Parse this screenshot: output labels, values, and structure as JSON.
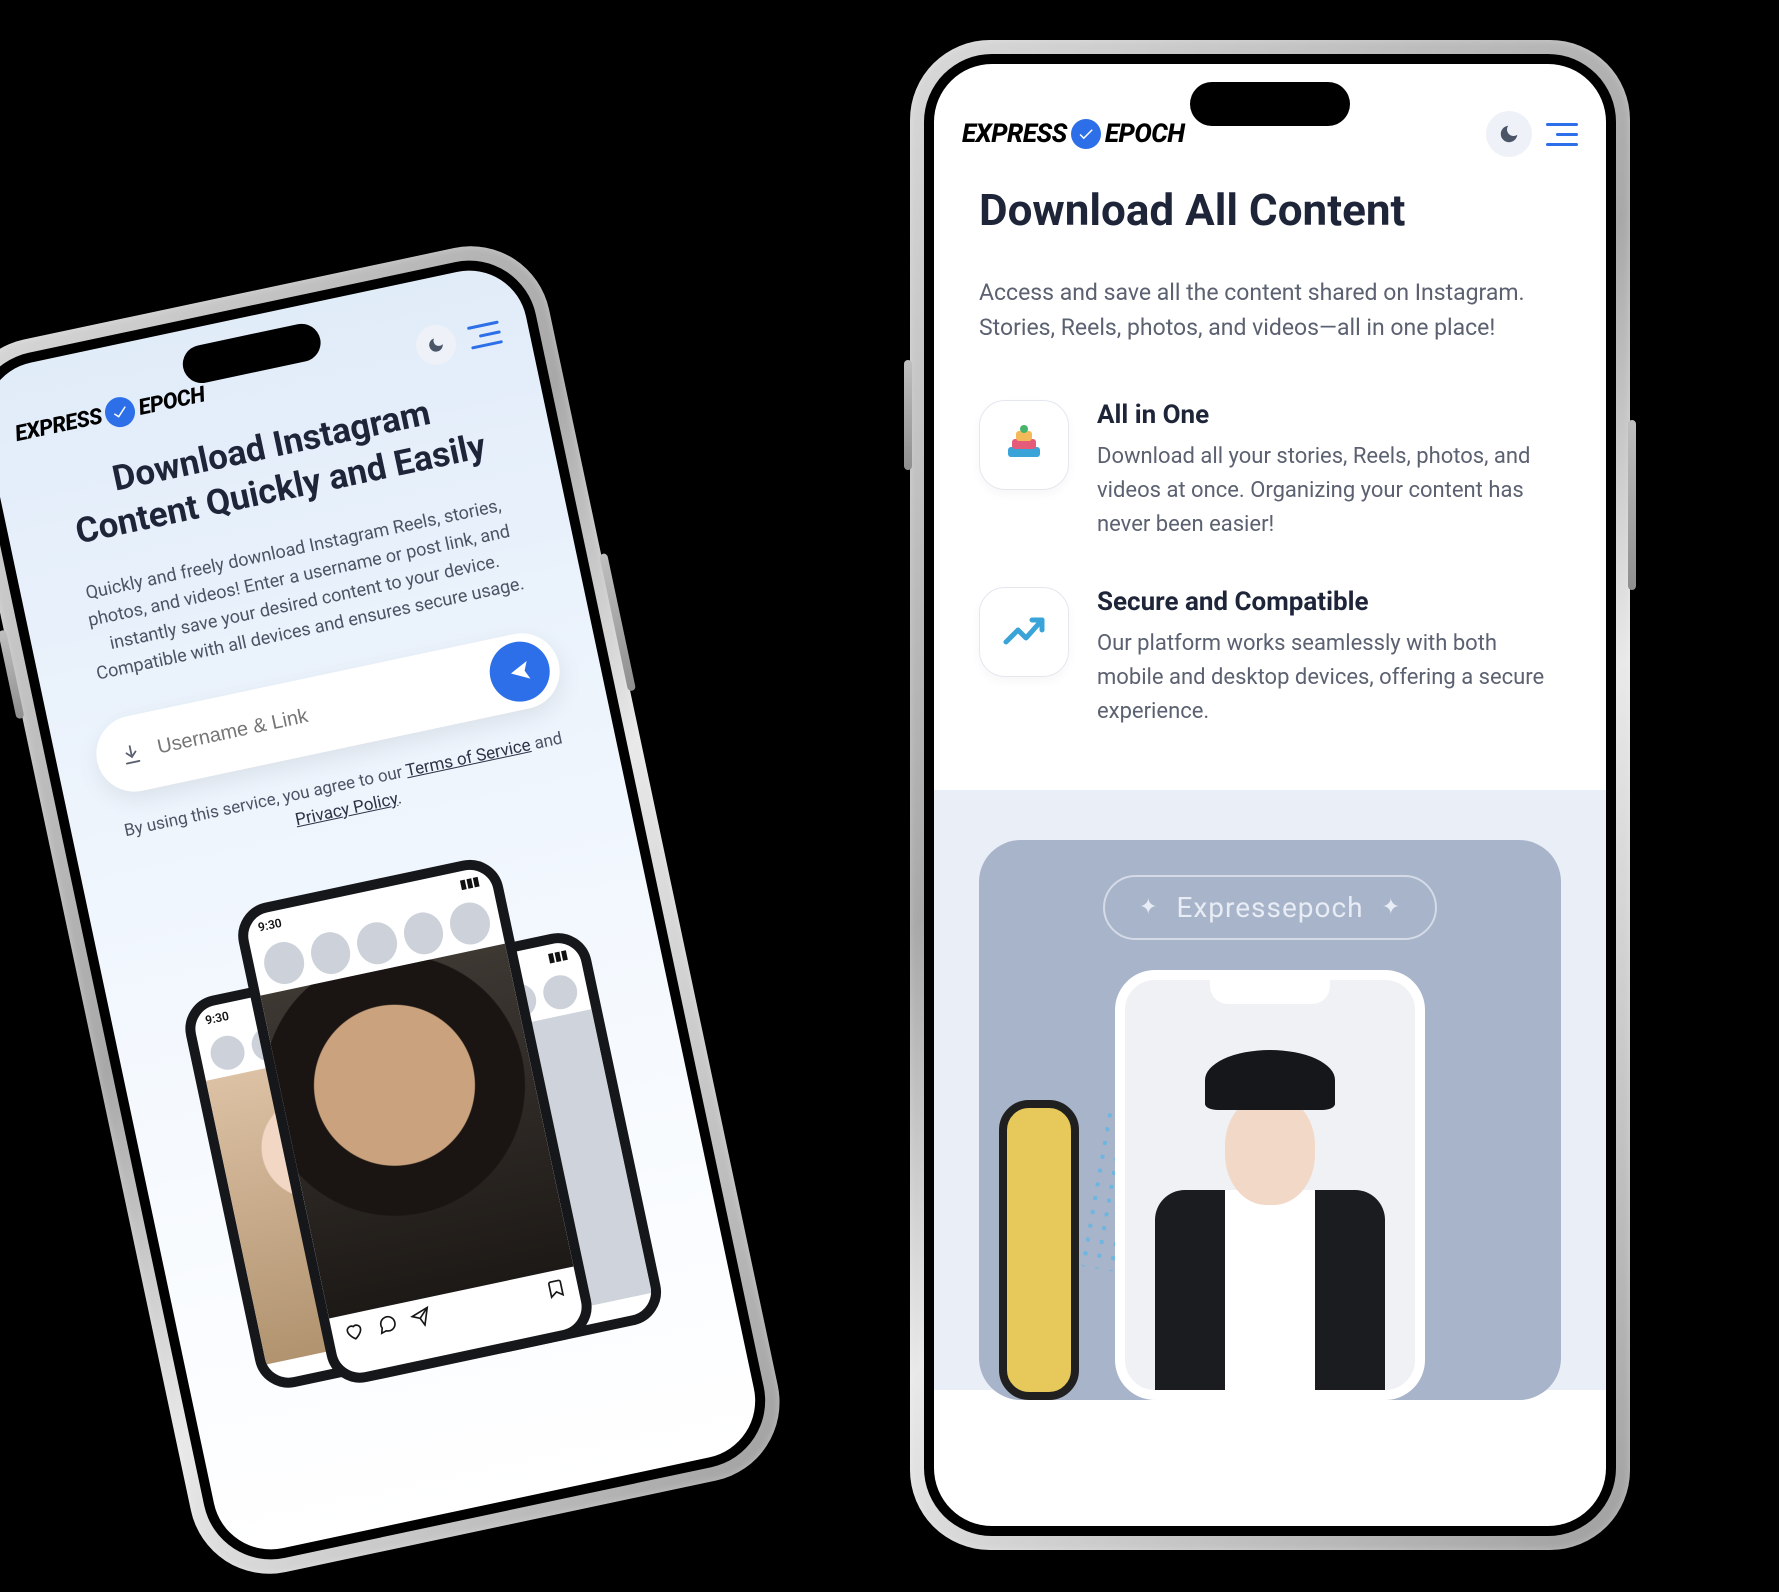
{
  "brand": {
    "prefix": "EXPRESS",
    "suffix": "EPOCH"
  },
  "icons": {
    "theme": "moon-icon",
    "menu": "hamburger-icon",
    "download": "download-icon",
    "send": "send-icon",
    "feature_all": "carousel-stack-icon",
    "feature_secure": "trend-arrow-icon"
  },
  "left": {
    "title_line1": "Download Instagram",
    "title_line2": "Content Quickly and Easily",
    "lead": "Quickly and freely download Instagram Reels, stories, photos, and videos! Enter a username or post link, and instantly save your desired content to your device. Compatible with all devices and ensures secure usage.",
    "placeholder": "Username & Link",
    "tos_pre": "By using this service, you agree to our ",
    "tos_link": "Terms of Service",
    "tos_mid": " and ",
    "pp_link": "Privacy Policy",
    "status_time": "9:30"
  },
  "right": {
    "title": "Download All Content",
    "subtitle": "Access and save all the content shared on Instagram. Stories, Reels, photos, and videos—all in one place!",
    "features": [
      {
        "title": "All in One",
        "desc": "Download all your stories, Reels, photos, and videos at once. Organizing your content has never been easier!"
      },
      {
        "title": "Secure and Compatible",
        "desc": "Our platform works seamlessly with both mobile and desktop devices, offering a secure experience."
      }
    ],
    "promo_label": "Expressepoch"
  }
}
